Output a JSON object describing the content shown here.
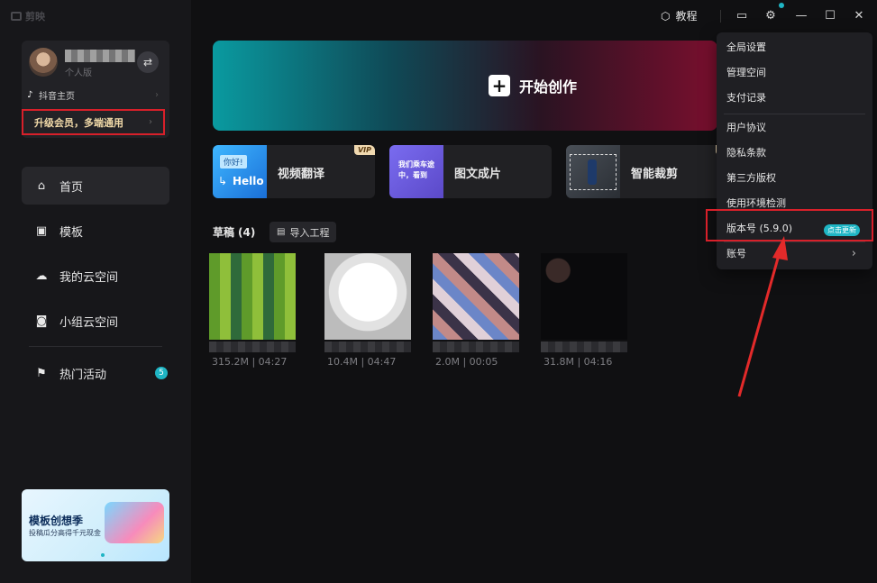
{
  "app": {
    "logo": "剪映"
  },
  "user": {
    "subtitle": "个人版",
    "douyin_label": "抖音主页",
    "vip_label": "升级会员，多端通用"
  },
  "nav": {
    "items": [
      {
        "label": "首页",
        "icon": "home-icon"
      },
      {
        "label": "模板",
        "icon": "template-icon"
      },
      {
        "label": "我的云空间",
        "icon": "cloud-icon"
      },
      {
        "label": "小组云空间",
        "icon": "group-cloud-icon"
      },
      {
        "label": "热门活动",
        "icon": "flag-icon",
        "badge": "5"
      }
    ]
  },
  "banner": {
    "title": "模板创想季",
    "subtitle": "投稿瓜分高得千元现金"
  },
  "topbar": {
    "tutorial_label": "教程"
  },
  "hero": {
    "label": "开始创作"
  },
  "features": [
    {
      "label": "视频翻译",
      "vip": "VIP",
      "thumb_text_1": "你好!",
      "thumb_text_2": "Hello"
    },
    {
      "label": "图文成片",
      "thumb_text": "我们乘车途中，看到"
    },
    {
      "label": "智能裁剪",
      "vip": "V"
    }
  ],
  "drafts": {
    "title": "草稿",
    "count": "(4)",
    "import_label": "导入工程",
    "items": [
      {
        "meta": "315.2M | 04:27"
      },
      {
        "meta": "10.4M | 04:47"
      },
      {
        "meta": "2.0M | 00:05"
      },
      {
        "meta": "31.8M | 04:16"
      }
    ]
  },
  "menu": {
    "items": [
      "全局设置",
      "管理空间",
      "支付记录",
      "用户协议",
      "隐私条款",
      "第三方版权",
      "使用环境检测",
      "版本号 (5.9.0)",
      "账号"
    ],
    "update_badge": "点击更新"
  },
  "colors": {
    "accent": "#1fb5c4",
    "highlight": "#d8202a",
    "vip_gold": "#f0d9a8"
  }
}
